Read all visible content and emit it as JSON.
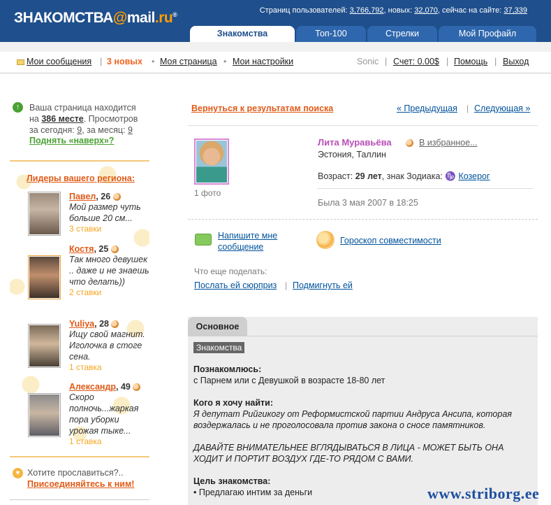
{
  "header": {
    "logo_main": "ЗНАКОМСТВА",
    "logo_at": "@",
    "logo_mail": "mail",
    "logo_ru": ".ru",
    "logo_reg": "®",
    "stats_prefix": "Страниц пользователей:",
    "stats_users": "3,766,792",
    "stats_new_label": ", новых:",
    "stats_new": "32,070",
    "stats_online_label": ", сейчас на сайте:",
    "stats_online": "37,339"
  },
  "tabs": [
    {
      "label": "Знакомства",
      "active": true
    },
    {
      "label": "Топ-100",
      "active": false
    },
    {
      "label": "Стрелки",
      "active": false
    },
    {
      "label": "Мой Профайл",
      "active": false
    }
  ],
  "nav": {
    "messages": "Мои сообщения",
    "new_count": "3 новых",
    "my_page": "Моя страница",
    "settings": "Мои настройки",
    "user": "Sonic",
    "account": "Счет: 0.00$",
    "help": "Помощь",
    "logout": "Выход"
  },
  "left": {
    "page_pos_1": "Ваша страница находится",
    "page_pos_2": "на",
    "page_pos_place": "386 месте",
    "page_pos_3": ". Просмотров",
    "views_today_label": "за сегодня:",
    "views_today": "9",
    "views_month_label": ", за месяц:",
    "views_month": "9",
    "raise_link": "Поднять «наверх»?",
    "leaders_title": "Лидеры вашего региона:",
    "leaders": [
      {
        "name": "Павел",
        "age": ", 26",
        "text": "Мой размер чуть больше 20 см...",
        "bids": "3 ставки"
      },
      {
        "name": "Костя",
        "age": ", 25",
        "text": "Так много девушек .. даже и не знаешь что делать))",
        "bids": "2 ставки"
      },
      {
        "name": "Yuliya",
        "age": ", 28",
        "text": "Ищу свой магнит. Иголочка в стоге сена.",
        "bids": "1 ставка"
      },
      {
        "name": "Александр",
        "age": ", 49",
        "text": "Скоро полночь...жаркая пора уборки урожая тыке...",
        "bids": "1 ставка"
      }
    ],
    "fame_q": "Хотите прославиться?..",
    "fame_link": "Присоединяйтесь к ним!"
  },
  "main": {
    "back_link": "Вернуться к результатам поиска",
    "prev": "« Предыдущая",
    "next": "Следующая »",
    "photo_count": "1 фото",
    "name": "Лита Муравьёва",
    "favorites": "В избранное...",
    "location": "Эстония, Таллин",
    "age_label": "Возраст:",
    "age": "29 лет",
    "zodiac_label": ", знак Зодиака:",
    "zodiac_symbol": "♑",
    "zodiac": "Козерог",
    "last_seen": "Была 3 мая 2007 в 18:25",
    "write_msg": "Напишите мне сообщение",
    "horoscope": "Гороскоп совместимости",
    "more_label": "Что еще поделать:",
    "surprise": "Послать ей сюрприз",
    "wink": "Подмигнуть ей",
    "tab_main": "Основное",
    "section_badge": "Знакомства",
    "meet_label": "Познакомлюсь:",
    "meet_value": "с Парнем или с Девушкой в возрасте 18-80 лет",
    "find_label": "Кого я хочу найти:",
    "find_value": "Я депутат Рийгикогу от Реформистской партии Андруса Ансипа, которая воздержалась и не проголосовала против закона о сносе памятников.",
    "find_value2": "ДАВАЙТЕ ВНИМАТЕЛЬНЕЕ ВГЛЯДЫВАТЬСЯ В ЛИЦА - МОЖЕТ БЫТЬ ОНА ХОДИТ И ПОРТИТ ВОЗДУХ ГДЕ-ТО РЯДОМ С ВАМИ.",
    "goal_label": "Цель знакомства:",
    "goal_item": "Предлагаю интим за деньги"
  },
  "watermark": "www.striborg.ee"
}
